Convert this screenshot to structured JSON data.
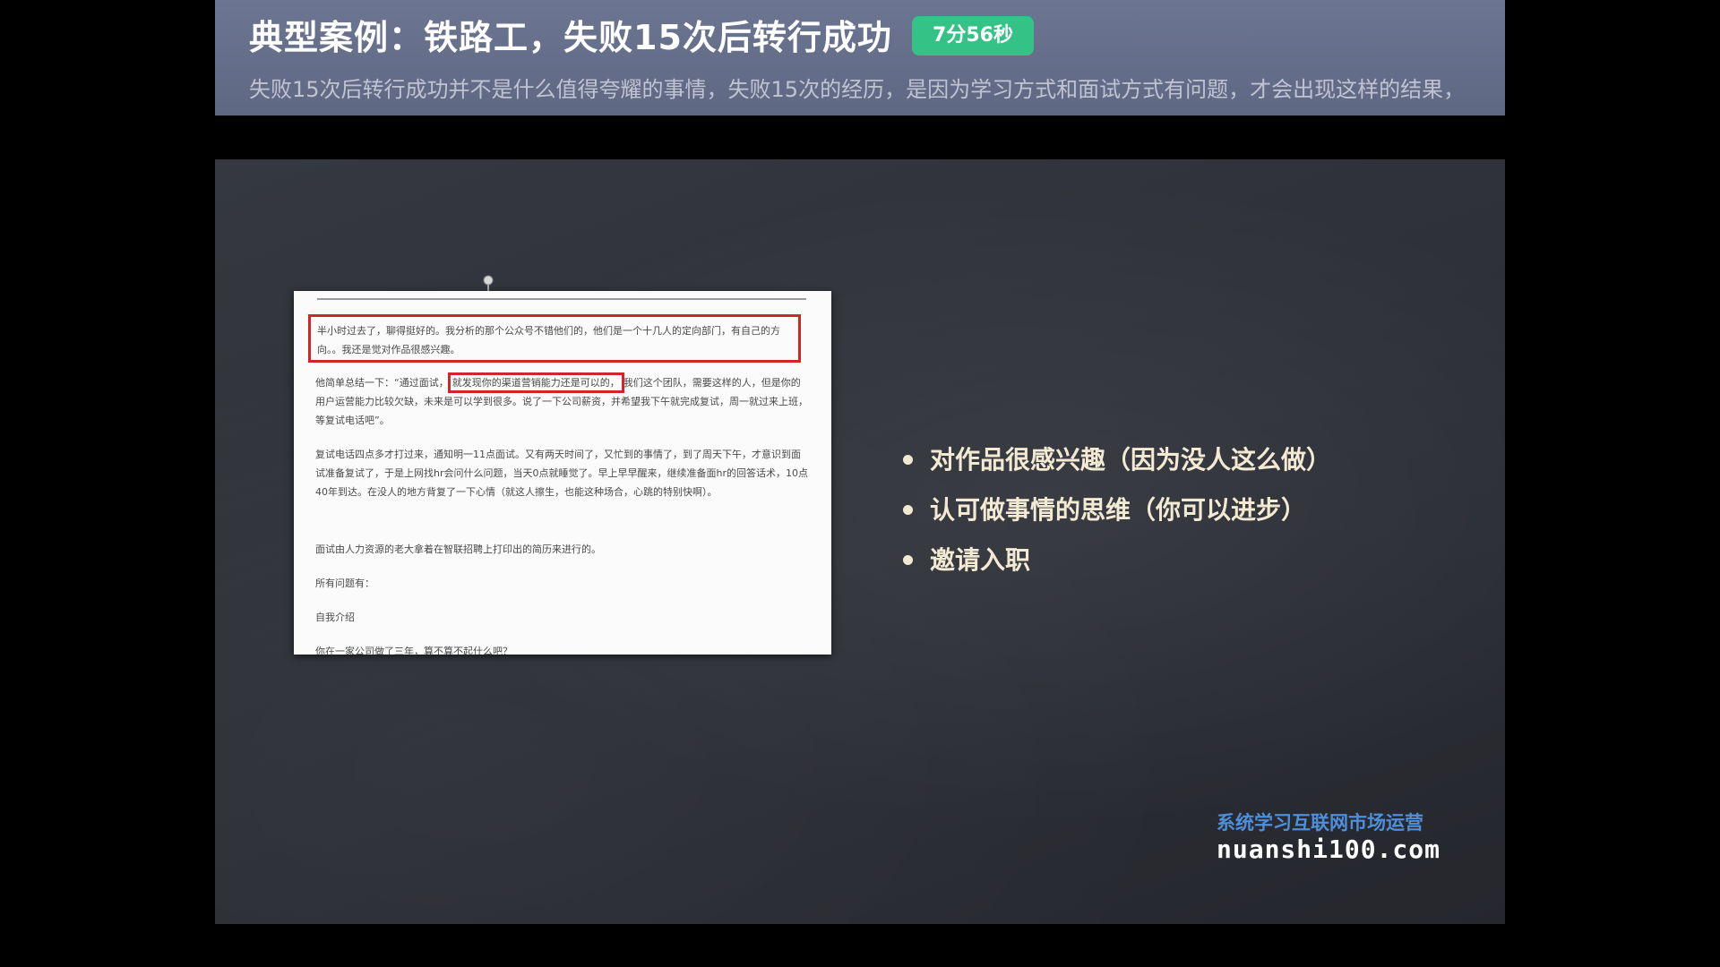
{
  "header": {
    "title": "典型案例：铁路工，失败15次后转行成功",
    "duration_badge": "7分56秒",
    "subtitle": "失败15次后转行成功并不是什么值得夸耀的事情，失败15次的经历，是因为学习方式和面试方式有问题，才会出现这样的结果，"
  },
  "document": {
    "para1": "半小时过去了，聊得挺好的。我分析的那个公众号不错他们的，他们是一个十几人的定向部门，有自己的方向。。我还是觉对作品很感兴趣。",
    "para2_prefix": "他简单总结一下：“通过面试，",
    "para2_highlight": "就发现你的渠道营销能力还是可以的，",
    "para2_rest": "我们这个团队，需要这样的人，但是你的用户运营能力比较欠缺，未来是可以学到很多。说了一下公司薪资，并希望我下午就完成复试，周一就过来上班，等复试电话吧”。",
    "para3": "复试电话四点多才打过来，通知明一11点面试。又有两天时间了，又忙到的事情了，到了周天下午，才意识到面试准备复试了，于是上网找hr会问什么问题，当天0点就睡觉了。早上早早醒来，继续准备面hr的回答话术，10点40年到达。在没人的地方背复了一下心情（就这人擦生，也能这种场合，心跳的特别快啊）。",
    "para4": "面试由人力资源的老大拿着在智联招聘上打印出的简历来进行的。",
    "para5": "所有问题有：",
    "para6": "自我介绍",
    "para7": "你在一家公司做了三年，算不算不起什么吧？"
  },
  "bullets": [
    "对作品很感兴趣（因为没人这么做）",
    "认可做事情的思维（你可以进步）",
    "邀请入职"
  ],
  "watermark": {
    "slogan": "系统学习互联网市场运营",
    "url": "nuanshi100.com"
  }
}
